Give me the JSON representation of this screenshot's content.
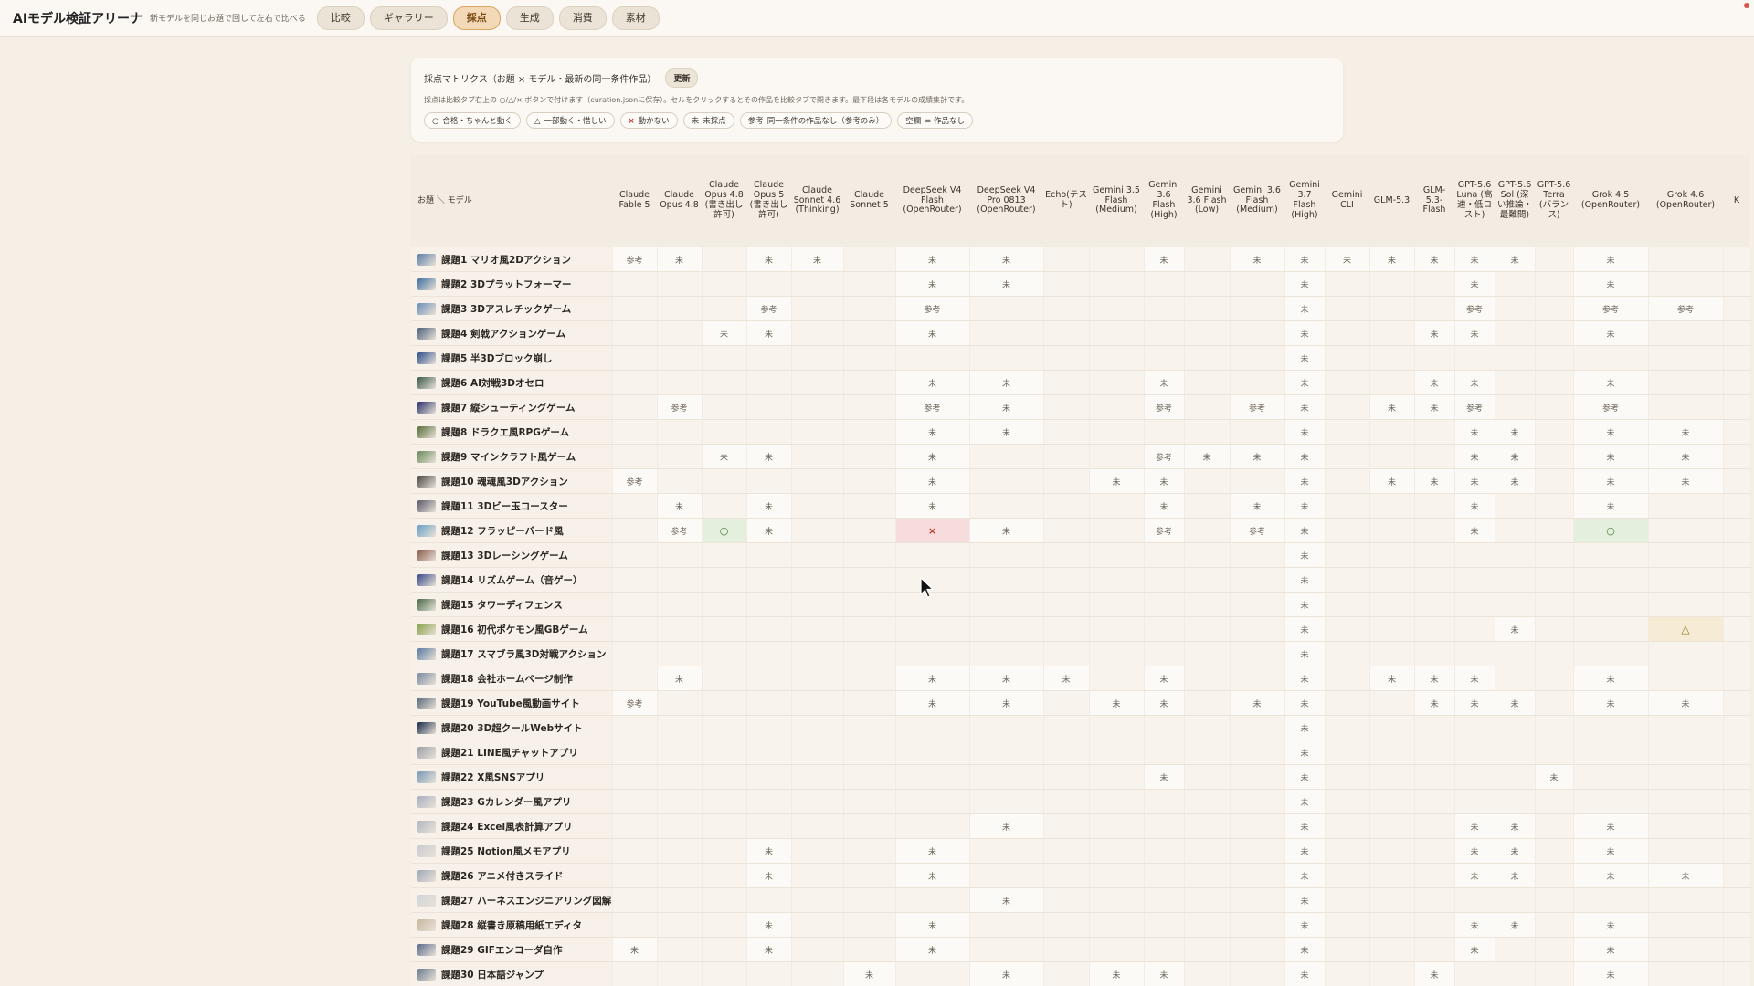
{
  "header": {
    "title": "AIモデル検証アリーナ",
    "subtitle": "新モデルを同じお題で回して左右で比べる",
    "tabs": [
      {
        "label": "比較",
        "active": false
      },
      {
        "label": "ギャラリー",
        "active": false
      },
      {
        "label": "採点",
        "active": true
      },
      {
        "label": "生成",
        "active": false
      },
      {
        "label": "消費",
        "active": false
      },
      {
        "label": "素材",
        "active": false
      }
    ]
  },
  "panel": {
    "title": "採点マトリクス（お題 × モデル・最新の同一条件作品）",
    "refresh_label": "更新",
    "description": "採点は比較タブ右上の ○/△/× ボタンで付けます（curation.jsonに保存）。セルをクリックするとその作品を比較タブで開きます。最下段は各モデルの成績集計です。",
    "legend": [
      {
        "symbol": "○",
        "text": "合格・ちゃんと動く"
      },
      {
        "symbol": "△",
        "text": "一部動く・惜しい"
      },
      {
        "symbol": "×",
        "text": "動かない"
      },
      {
        "symbol": "未",
        "text": "未採点"
      },
      {
        "symbol": "参考",
        "text": "同一条件の作品なし（参考のみ）"
      },
      {
        "symbol": "空欄",
        "text": "= 作品なし"
      }
    ]
  },
  "matrix": {
    "corner_label": "お題 ＼ モデル",
    "models": [
      "Claude Fable 5",
      "Claude Opus 4.8",
      "Claude Opus 4.8 (書き出し許可)",
      "Claude Opus 5 (書き出し許可)",
      "Claude Sonnet 4.6 (Thinking)",
      "Claude Sonnet 5",
      "DeepSeek V4 Flash (OpenRouter)",
      "DeepSeek V4 Pro 0813 (OpenRouter)",
      "Echo(テスト)",
      "Gemini 3.5 Flash (Medium)",
      "Gemini 3.6 Flash (High)",
      "Gemini 3.6 Flash (Low)",
      "Gemini 3.6 Flash (Medium)",
      "Gemini 3.7 Flash (High)",
      "Gemini CLI",
      "GLM-5.3",
      "GLM-5.3-Flash",
      "GPT-5.6 Luna (高速・低コスト)",
      "GPT-5.6 Sol (深い推論・最難問)",
      "GPT-5.6 Terra (バランス)",
      "Grok 4.5 (OpenRouter)",
      "Grok 4.6 (OpenRouter)",
      "K"
    ],
    "tasks": [
      {
        "name": "課題1 マリオ風2Dアクション",
        "thumb": "#5d7ea8",
        "cells": [
          "参考",
          "未",
          "",
          "未",
          "未",
          "",
          "未",
          "未",
          "",
          "",
          "未",
          "",
          "未",
          "未",
          "未",
          "未",
          "未",
          "未",
          "未",
          "",
          "未",
          "",
          ""
        ]
      },
      {
        "name": "課題2 3Dプラットフォーマー",
        "thumb": "#3f6fa0",
        "cells": [
          "",
          "",
          "",
          "",
          "",
          "",
          "未",
          "未",
          "",
          "",
          "",
          "",
          "",
          "未",
          "",
          "",
          "",
          "未",
          "",
          "",
          "未",
          "",
          ""
        ]
      },
      {
        "name": "課題3 3Dアスレチックゲーム",
        "thumb": "#6c8fb8",
        "cells": [
          "",
          "",
          "",
          "参考",
          "",
          "",
          "参考",
          "",
          "",
          "",
          "",
          "",
          "",
          "未",
          "",
          "",
          "",
          "参考",
          "",
          "",
          "参考",
          "参考",
          ""
        ]
      },
      {
        "name": "課題4 剣戟アクションゲーム",
        "thumb": "#4a5f7a",
        "cells": [
          "",
          "",
          "未",
          "未",
          "",
          "",
          "未",
          "",
          "",
          "",
          "",
          "",
          "",
          "未",
          "",
          "",
          "未",
          "未",
          "",
          "",
          "未",
          "",
          ""
        ]
      },
      {
        "name": "課題5 半3Dブロック崩し",
        "thumb": "#2f4f8a",
        "cells": [
          "",
          "",
          "",
          "",
          "",
          "",
          "",
          "",
          "",
          "",
          "",
          "",
          "",
          "未",
          "",
          "",
          "",
          "",
          "",
          "",
          "",
          "",
          ""
        ]
      },
      {
        "name": "課題6 AI対戦3Dオセロ",
        "thumb": "#3d5a4a",
        "cells": [
          "",
          "",
          "",
          "",
          "",
          "",
          "未",
          "未",
          "",
          "",
          "未",
          "",
          "",
          "未",
          "",
          "",
          "未",
          "未",
          "",
          "",
          "未",
          "",
          ""
        ]
      },
      {
        "name": "課題7 縦シューティングゲーム",
        "thumb": "#2a2f6a",
        "cells": [
          "",
          "参考",
          "",
          "",
          "",
          "",
          "参考",
          "未",
          "",
          "",
          "参考",
          "",
          "参考",
          "未",
          "",
          "未",
          "未",
          "参考",
          "",
          "",
          "参考",
          "",
          ""
        ]
      },
      {
        "name": "課題8 ドラクエ風RPGゲーム",
        "thumb": "#5a6e3a",
        "cells": [
          "",
          "",
          "",
          "",
          "",
          "",
          "未",
          "未",
          "",
          "",
          "",
          "",
          "",
          "未",
          "",
          "",
          "",
          "未",
          "未",
          "",
          "未",
          "未",
          ""
        ]
      },
      {
        "name": "課題9 マインクラフト風ゲーム",
        "thumb": "#6a8a5a",
        "cells": [
          "",
          "",
          "未",
          "未",
          "",
          "",
          "未",
          "",
          "",
          "",
          "参考",
          "未",
          "未",
          "未",
          "",
          "",
          "",
          "未",
          "未",
          "",
          "未",
          "未",
          ""
        ]
      },
      {
        "name": "課題10 魂魂風3Dアクション",
        "thumb": "#4a4540",
        "cells": [
          "参考",
          "",
          "",
          "",
          "",
          "",
          "未",
          "",
          "",
          "未",
          "未",
          "",
          "",
          "未",
          "",
          "未",
          "未",
          "未",
          "未",
          "",
          "未",
          "未",
          ""
        ]
      },
      {
        "name": "課題11 3Dビー玉コースター",
        "thumb": "#5a5a6a",
        "cells": [
          "",
          "未",
          "",
          "未",
          "",
          "",
          "未",
          "",
          "",
          "",
          "未",
          "",
          "未",
          "未",
          "",
          "",
          "",
          "未",
          "",
          "",
          "未",
          "",
          ""
        ]
      },
      {
        "name": "課題12 フラッピーバード風",
        "thumb": "#6aa0c8",
        "cells": [
          "",
          "参考",
          "○",
          "未",
          "",
          "",
          "×",
          "未",
          "",
          "",
          "参考",
          "",
          "参考",
          "未",
          "",
          "",
          "",
          "未",
          "",
          "",
          "○",
          "",
          ""
        ]
      },
      {
        "name": "課題13 3Dレーシングゲーム",
        "thumb": "#8a5a4a",
        "cells": [
          "",
          "",
          "",
          "",
          "",
          "",
          "",
          "",
          "",
          "",
          "",
          "",
          "",
          "未",
          "",
          "",
          "",
          "",
          "",
          "",
          "",
          "",
          ""
        ]
      },
      {
        "name": "課題14 リズムゲーム（音ゲー）",
        "thumb": "#3a4a8a",
        "cells": [
          "",
          "",
          "",
          "",
          "",
          "",
          "",
          "",
          "",
          "",
          "",
          "",
          "",
          "未",
          "",
          "",
          "",
          "",
          "",
          "",
          "",
          "",
          ""
        ]
      },
      {
        "name": "課題15 タワーディフェンス",
        "thumb": "#4a6a4a",
        "cells": [
          "",
          "",
          "",
          "",
          "",
          "",
          "",
          "",
          "",
          "",
          "",
          "",
          "",
          "未",
          "",
          "",
          "",
          "",
          "",
          "",
          "",
          "",
          ""
        ]
      },
      {
        "name": "課題16 初代ポケモン風GBゲーム",
        "thumb": "#8aa04a",
        "cells": [
          "",
          "",
          "",
          "",
          "",
          "",
          "",
          "",
          "",
          "",
          "",
          "",
          "",
          "未",
          "",
          "",
          "",
          "",
          "未",
          "",
          "",
          "△",
          ""
        ]
      },
      {
        "name": "課題17 スマブラ風3D対戦アクション",
        "thumb": "#5a7aa0",
        "cells": [
          "",
          "",
          "",
          "",
          "",
          "",
          "",
          "",
          "",
          "",
          "",
          "",
          "",
          "未",
          "",
          "",
          "",
          "",
          "",
          "",
          "",
          "",
          ""
        ]
      },
      {
        "name": "課題18 会社ホームページ制作",
        "thumb": "#7a8aa0",
        "cells": [
          "",
          "未",
          "",
          "",
          "",
          "",
          "未",
          "未",
          "未",
          "",
          "未",
          "",
          "",
          "未",
          "",
          "未",
          "未",
          "未",
          "",
          "",
          "未",
          "",
          ""
        ]
      },
      {
        "name": "課題19 YouTube風動画サイト",
        "thumb": "#5a6a7a",
        "cells": [
          "参考",
          "",
          "",
          "",
          "",
          "",
          "未",
          "未",
          "",
          "未",
          "未",
          "",
          "未",
          "未",
          "",
          "",
          "未",
          "未",
          "未",
          "",
          "未",
          "未",
          ""
        ]
      },
      {
        "name": "課題20 3D超クールWebサイト",
        "thumb": "#1a2a4a",
        "cells": [
          "",
          "",
          "",
          "",
          "",
          "",
          "",
          "",
          "",
          "",
          "",
          "",
          "",
          "未",
          "",
          "",
          "",
          "",
          "",
          "",
          "",
          "",
          ""
        ]
      },
      {
        "name": "課題21 LINE風チャットアプリ",
        "thumb": "#9aa0a8",
        "cells": [
          "",
          "",
          "",
          "",
          "",
          "",
          "",
          "",
          "",
          "",
          "",
          "",
          "",
          "未",
          "",
          "",
          "",
          "",
          "",
          "",
          "",
          "",
          ""
        ]
      },
      {
        "name": "課題22 X風SNSアプリ",
        "thumb": "#7a9ab8",
        "cells": [
          "",
          "",
          "",
          "",
          "",
          "",
          "",
          "",
          "",
          "",
          "未",
          "",
          "",
          "未",
          "",
          "",
          "",
          "",
          "",
          "未",
          "",
          "",
          ""
        ]
      },
      {
        "name": "課題23 Gカレンダー風アプリ",
        "thumb": "#a8b0c0",
        "cells": [
          "",
          "",
          "",
          "",
          "",
          "",
          "",
          "",
          "",
          "",
          "",
          "",
          "",
          "未",
          "",
          "",
          "",
          "",
          "",
          "",
          "",
          "",
          ""
        ]
      },
      {
        "name": "課題24 Excel風表計算アプリ",
        "thumb": "#b0b8c0",
        "cells": [
          "",
          "",
          "",
          "",
          "",
          "",
          "",
          "未",
          "",
          "",
          "",
          "",
          "",
          "未",
          "",
          "",
          "",
          "未",
          "未",
          "",
          "未",
          "",
          ""
        ]
      },
      {
        "name": "課題25 Notion風メモアプリ",
        "thumb": "#c8ccd0",
        "cells": [
          "",
          "",
          "",
          "未",
          "",
          "",
          "未",
          "",
          "",
          "",
          "",
          "",
          "",
          "未",
          "",
          "",
          "",
          "未",
          "未",
          "",
          "未",
          "",
          ""
        ]
      },
      {
        "name": "課題26 アニメ付きスライド",
        "thumb": "#a0a8b8",
        "cells": [
          "",
          "",
          "",
          "未",
          "",
          "",
          "未",
          "",
          "",
          "",
          "",
          "",
          "",
          "未",
          "",
          "",
          "",
          "未",
          "未",
          "",
          "未",
          "未",
          ""
        ]
      },
      {
        "name": "課題27 ハーネスエンジニアリング図解",
        "thumb": "#d0d4d8",
        "cells": [
          "",
          "",
          "",
          "",
          "",
          "",
          "",
          "未",
          "",
          "",
          "",
          "",
          "",
          "未",
          "",
          "",
          "",
          "",
          "",
          "",
          "",
          "",
          ""
        ]
      },
      {
        "name": "課題28 縦書き原稿用紙エディタ",
        "thumb": "#c8b8a0",
        "cells": [
          "",
          "",
          "",
          "未",
          "",
          "",
          "未",
          "",
          "",
          "",
          "",
          "",
          "",
          "未",
          "",
          "",
          "",
          "未",
          "未",
          "",
          "未",
          "",
          ""
        ]
      },
      {
        "name": "課題29 GIFエンコーダ自作",
        "thumb": "#5a6a8a",
        "cells": [
          "未",
          "",
          "",
          "未",
          "",
          "",
          "未",
          "",
          "",
          "",
          "",
          "",
          "",
          "未",
          "",
          "",
          "",
          "未",
          "",
          "",
          "未",
          "",
          ""
        ]
      },
      {
        "name": "課題30 日本語ジャンプ",
        "thumb": "#6a7a8a",
        "cells": [
          "",
          "",
          "",
          "",
          "",
          "未",
          "",
          "未",
          "",
          "未",
          "未",
          "",
          "",
          "未",
          "",
          "",
          "未",
          "",
          "",
          "",
          "未",
          "",
          ""
        ]
      }
    ]
  }
}
